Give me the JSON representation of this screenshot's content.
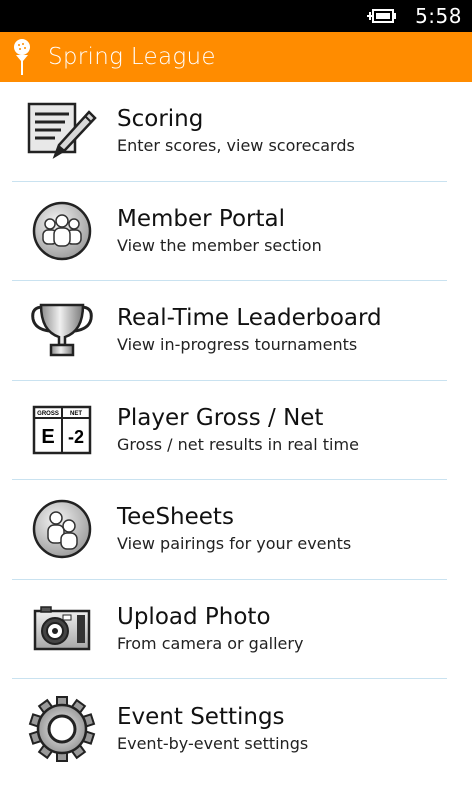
{
  "status": {
    "time": "5:58"
  },
  "header": {
    "title": "Spring League"
  },
  "menu": [
    {
      "icon": "scorecard-pencil-icon",
      "title": "Scoring",
      "subtitle": "Enter scores, view scorecards"
    },
    {
      "icon": "members-group-icon",
      "title": "Member Portal",
      "subtitle": "View the member section"
    },
    {
      "icon": "trophy-icon",
      "title": "Real-Time Leaderboard",
      "subtitle": "View in-progress tournaments"
    },
    {
      "icon": "gross-net-icon",
      "title": "Player Gross / Net",
      "subtitle": "Gross / net results in real time",
      "icon_labels": {
        "left_header": "GROSS",
        "right_header": "NET",
        "left_value": "E",
        "right_value": "-2"
      }
    },
    {
      "icon": "pairings-icon",
      "title": "TeeSheets",
      "subtitle": "View pairings for your events"
    },
    {
      "icon": "camera-icon",
      "title": "Upload Photo",
      "subtitle": "From camera or gallery"
    },
    {
      "icon": "gear-icon",
      "title": "Event Settings",
      "subtitle": "Event-by-event settings"
    }
  ],
  "colors": {
    "accent": "#ff8c00",
    "divider": "#c9e2f0",
    "status_bar": "#000000"
  }
}
